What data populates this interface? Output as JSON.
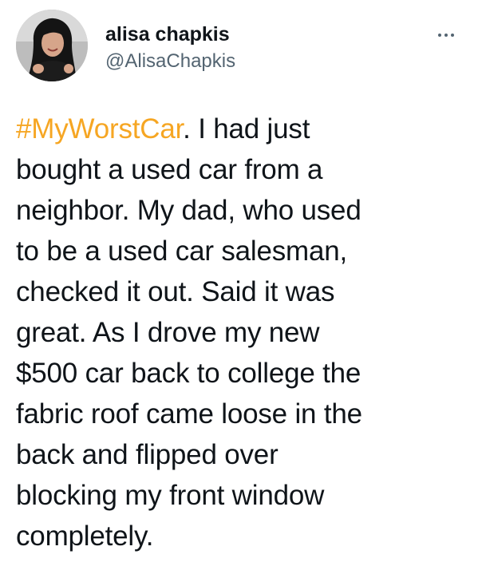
{
  "author": {
    "display_name": "alisa chapkis",
    "handle": "@AlisaChapkis",
    "avatar_icon": "profile-photo"
  },
  "menu": {
    "icon": "more-horizontal-icon"
  },
  "tweet": {
    "hashtag": "#MyWorstCar",
    "first_line_rest": ". I had just",
    "lines": [
      "bought a used car from a",
      "neighbor. My dad, who used",
      "to be a used car salesman,",
      "checked it out. Said it was",
      "great. As I drove my new",
      "$500 car back to college the",
      "fabric roof came loose in the",
      "back and flipped over",
      "blocking my front window",
      "completely."
    ]
  },
  "colors": {
    "hashtag": "#f6a623",
    "text": "#0f1419",
    "secondary": "#536471"
  }
}
